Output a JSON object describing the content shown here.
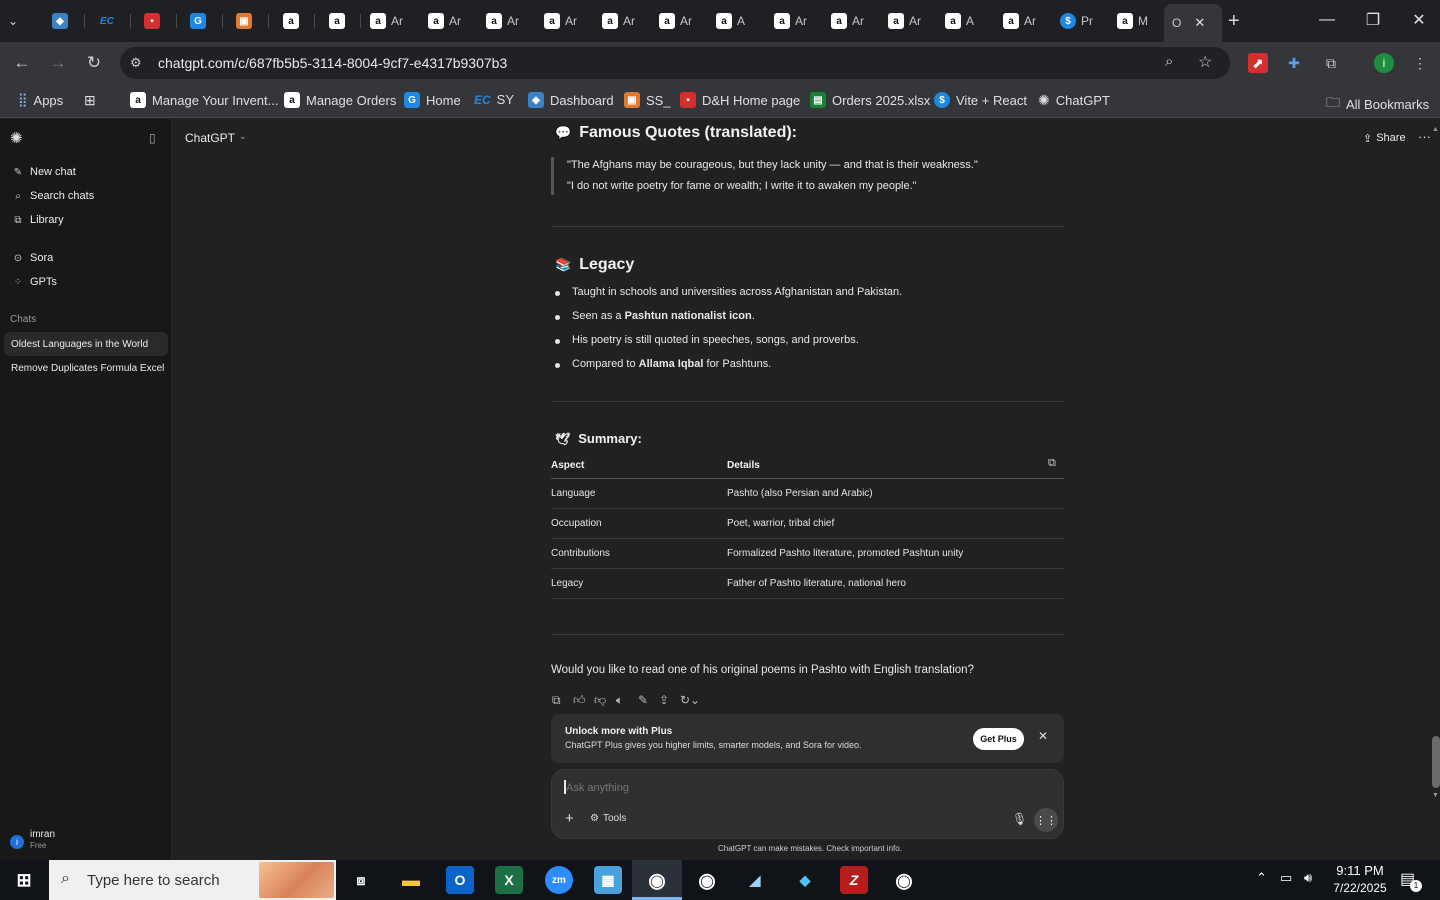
{
  "browser": {
    "tabs": [
      {
        "label": "",
        "icon": "chevron-down-icon"
      },
      {
        "label": "",
        "icon": "hex-icon"
      },
      {
        "label": "",
        "icon": "ec-icon"
      },
      {
        "label": "",
        "icon": "dh-icon"
      },
      {
        "label": "",
        "icon": "g-icon"
      },
      {
        "label": "",
        "icon": "box-icon"
      },
      {
        "label": "",
        "icon": "amazon-icon"
      },
      {
        "label": "",
        "icon": "amazon-icon"
      },
      {
        "label": "Ar",
        "icon": "amazon-icon"
      },
      {
        "label": "Ar",
        "icon": "amazon-icon"
      },
      {
        "label": "Ar",
        "icon": "amazon-icon"
      },
      {
        "label": "Ar",
        "icon": "amazon-icon"
      },
      {
        "label": "Ar",
        "icon": "amazon-icon"
      },
      {
        "label": "Ar",
        "icon": "amazon-icon"
      },
      {
        "label": "A",
        "icon": "amazon-icon"
      },
      {
        "label": "Ar",
        "icon": "amazon-icon"
      },
      {
        "label": "Ar",
        "icon": "amazon-icon"
      },
      {
        "label": "Ar",
        "icon": "amazon-icon"
      },
      {
        "label": "A",
        "icon": "amazon-icon"
      },
      {
        "label": "Ar",
        "icon": "amazon-icon"
      },
      {
        "label": "Pr",
        "icon": "dollar-icon"
      },
      {
        "label": "M",
        "icon": "amazon-icon"
      },
      {
        "label": "O",
        "icon": "chatgpt-icon"
      }
    ],
    "url": "chatgpt.com/c/687fb5b5-3114-8004-9cf7-e4317b9307b3",
    "profile_initial": "i",
    "bookmarks": [
      {
        "label": "Apps",
        "icon": "apps-grid-icon"
      },
      {
        "label": "",
        "icon": "tab-groups-icon"
      },
      {
        "label": "Manage Your Invent...",
        "icon": "amazon-icon"
      },
      {
        "label": "Manage Orders",
        "icon": "amazon-icon"
      },
      {
        "label": "Home",
        "icon": "g-icon"
      },
      {
        "label": "SY",
        "icon": "ec-icon"
      },
      {
        "label": "Dashboard",
        "icon": "hex-icon"
      },
      {
        "label": "SS_",
        "icon": "box-icon"
      },
      {
        "label": "D&H Home page",
        "icon": "dh-icon"
      },
      {
        "label": "Orders 2025.xlsx",
        "icon": "sheets-icon"
      },
      {
        "label": "Vite + React",
        "icon": "dollar-icon"
      },
      {
        "label": "ChatGPT",
        "icon": "chatgpt-icon"
      }
    ],
    "all_bookmarks": "All Bookmarks"
  },
  "sidebar": {
    "new_chat": "New chat",
    "search_chats": "Search chats",
    "library": "Library",
    "sora": "Sora",
    "gpts": "GPTs",
    "chats_heading": "Chats",
    "chats": [
      "Oldest Languages in the World",
      "Remove Duplicates Formula Excel"
    ],
    "user_name": "imran",
    "user_plan": "Free",
    "user_initial": "i"
  },
  "header": {
    "model": "ChatGPT",
    "share": "Share"
  },
  "content": {
    "quotes_heading": "Famous Quotes (translated):",
    "quotes": [
      "\"The Afghans may be courageous, but they lack unity — and that is their weakness.\"",
      "\"I do not write poetry for fame or wealth; I write it to awaken my people.\""
    ],
    "legacy_heading": "Legacy",
    "legacy_items": [
      {
        "pre": "Taught in schools and universities across Afghanistan and Pakistan.",
        "bold": "",
        "post": ""
      },
      {
        "pre": "Seen as a ",
        "bold": "Pashtun nationalist icon",
        "post": "."
      },
      {
        "pre": "His poetry is still quoted in speeches, songs, and proverbs.",
        "bold": "",
        "post": ""
      },
      {
        "pre": "Compared to ",
        "bold": "Allama Iqbal",
        "post": " for Pashtuns."
      }
    ],
    "summary_heading": "Summary:",
    "table_headers": [
      "Aspect",
      "Details"
    ],
    "table_rows": [
      [
        "Language",
        "Pashto (also Persian and Arabic)"
      ],
      [
        "Occupation",
        "Poet, warrior, tribal chief"
      ],
      [
        "Contributions",
        "Formalized Pashto literature, promoted Pashtun unity"
      ],
      [
        "Legacy",
        "Father of Pashto literature, national hero"
      ]
    ],
    "followup": "Would you like to read one of his original poems in Pashto with English translation?"
  },
  "promo": {
    "title": "Unlock more with Plus",
    "subtitle": "ChatGPT Plus gives you higher limits, smarter models, and Sora for video.",
    "button": "Get Plus"
  },
  "composer": {
    "placeholder": "Ask anything",
    "tools": "Tools",
    "disclaimer": "ChatGPT can make mistakes. Check important info."
  },
  "taskbar": {
    "search_placeholder": "Type here to search",
    "time": "9:11 PM",
    "date": "7/22/2025",
    "notifications": "1"
  }
}
